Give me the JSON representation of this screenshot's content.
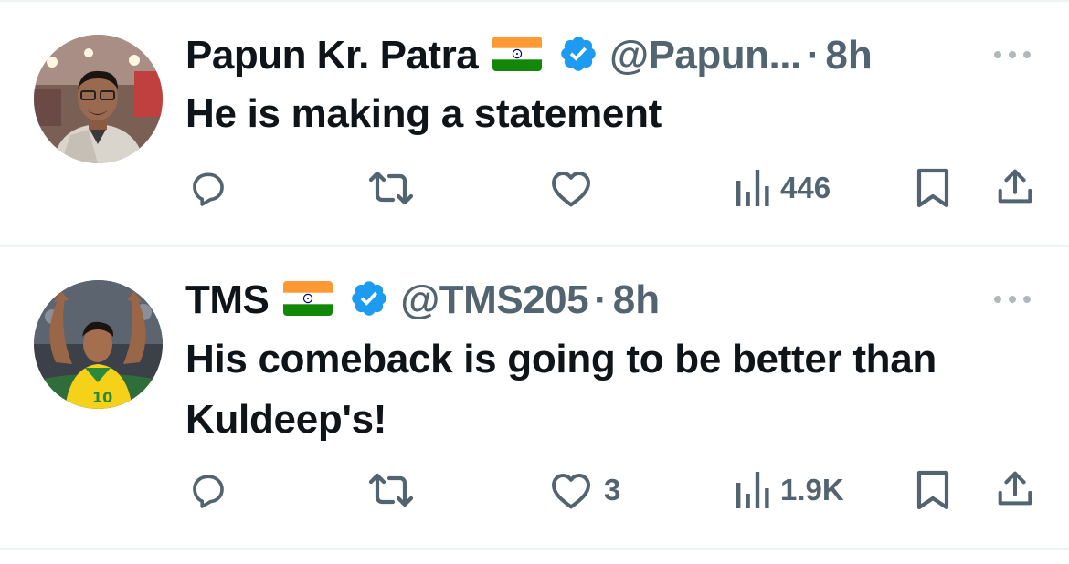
{
  "tweets": [
    {
      "author_name": "Papun Kr. Patra",
      "handle": "@Papun...",
      "separator": "·",
      "time": "8h",
      "text": "He is making a statement",
      "likes": "",
      "views": "446",
      "flag_icon": "india-flag-emoji",
      "verified_icon": "verified-badge-icon"
    },
    {
      "author_name": "TMS",
      "handle": "@TMS205",
      "separator": "·",
      "time": "8h",
      "text": "His comeback is going to be better than Kuldeep's!",
      "likes": "3",
      "views": "1.9K",
      "flag_icon": "india-flag-emoji",
      "verified_icon": "verified-badge-icon"
    }
  ],
  "colors": {
    "text_primary": "#0f1419",
    "text_secondary": "#536471",
    "verified_blue": "#1d9bf0",
    "divider": "#eff3f4"
  },
  "icons": [
    "reply-icon",
    "retweet-icon",
    "like-icon",
    "views-icon",
    "bookmark-icon",
    "share-icon",
    "more-icon"
  ]
}
